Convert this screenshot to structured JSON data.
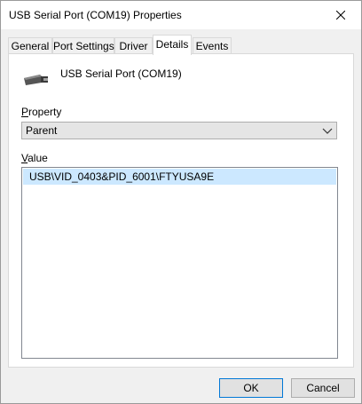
{
  "window": {
    "title": "USB Serial Port (COM19) Properties"
  },
  "tabs": [
    {
      "label": "General"
    },
    {
      "label": "Port Settings"
    },
    {
      "label": "Driver"
    },
    {
      "label": "Details",
      "active": true
    },
    {
      "label": "Events"
    }
  ],
  "details": {
    "device_name": "USB Serial Port (COM19)",
    "device_icon": "usb-connector-icon",
    "property_label_access": "P",
    "property_label_rest": "roperty",
    "property_selected": "Parent",
    "value_label_access": "V",
    "value_label_rest": "alue",
    "values": [
      "USB\\VID_0403&PID_6001\\FTYUSA9E"
    ]
  },
  "buttons": {
    "ok": "OK",
    "cancel": "Cancel"
  },
  "colors": {
    "selection": "#cce8ff",
    "default_button_border": "#0078d7"
  }
}
